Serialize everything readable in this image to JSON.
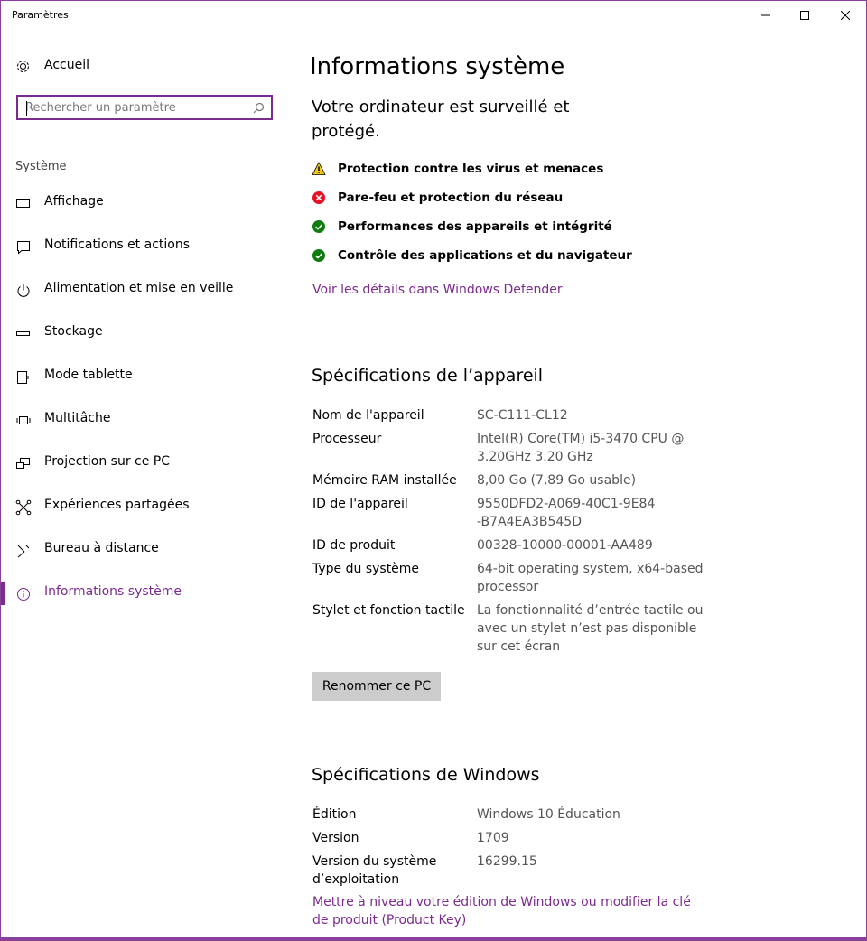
{
  "window": {
    "title": "Paramètres"
  },
  "sidebar": {
    "home_label": "Accueil",
    "search_placeholder": "Rechercher un paramètre",
    "section_label": "Système",
    "items": [
      {
        "label": "Affichage",
        "icon": "monitor-icon"
      },
      {
        "label": "Notifications et actions",
        "icon": "notification-icon"
      },
      {
        "label": "Alimentation et mise en veille",
        "icon": "power-icon"
      },
      {
        "label": "Stockage",
        "icon": "storage-icon"
      },
      {
        "label": "Mode tablette",
        "icon": "tablet-icon"
      },
      {
        "label": "Multitâche",
        "icon": "multitask-icon"
      },
      {
        "label": "Projection sur ce PC",
        "icon": "projection-icon"
      },
      {
        "label": "Expériences partagées",
        "icon": "share-icon"
      },
      {
        "label": "Bureau à distance",
        "icon": "remote-desktop-icon"
      },
      {
        "label": "Informations système",
        "icon": "info-icon",
        "active": true
      }
    ]
  },
  "main": {
    "title": "Informations système",
    "protection": {
      "heading": "Votre ordinateur est surveillé et protégé.",
      "items": [
        {
          "label": "Protection contre les virus et menaces",
          "status": "warning"
        },
        {
          "label": "Pare-feu et protection du réseau",
          "status": "error"
        },
        {
          "label": "Performances des appareils et intégrité",
          "status": "ok"
        },
        {
          "label": "Contrôle des applications et du navigateur",
          "status": "ok"
        }
      ],
      "link": "Voir les détails dans Windows Defender"
    },
    "device_specs": {
      "heading": "Spécifications de l’appareil",
      "rows": [
        {
          "key": "Nom de l'appareil",
          "value": "SC-C111-CL12"
        },
        {
          "key": "Processeur",
          "value": "Intel(R) Core(TM) i5-3470 CPU @ 3.20GHz   3.20 GHz"
        },
        {
          "key": "Mémoire RAM installée",
          "value": "8,00 Go (7,89 Go usable)"
        },
        {
          "key": "ID de l'appareil",
          "value": "9550DFD2-A069-40C1-9E84-B7A4EA3B545D"
        },
        {
          "key": "ID de produit",
          "value": "00328-10000-00001-AA489"
        },
        {
          "key": "Type du système",
          "value": "64-bit operating system, x64-based processor"
        },
        {
          "key": "Stylet et fonction tactile",
          "value": "La fonctionnalité d’entrée tactile ou avec un stylet n’est pas disponible sur cet écran"
        }
      ],
      "rename_button": "Renommer ce PC"
    },
    "windows_specs": {
      "heading": "Spécifications de Windows",
      "rows": [
        {
          "key": "Édition",
          "value": "Windows 10 Éducation"
        },
        {
          "key": "Version",
          "value": "1709"
        },
        {
          "key": "Version du système d’exploitation",
          "value": "16299.15"
        }
      ],
      "link": "Mettre à niveau votre édition de Windows ou modifier la clé de produit (Product Key)"
    }
  },
  "colors": {
    "accent": "#7b2a8e",
    "warning": "#f2c811",
    "error": "#e81123",
    "ok": "#107c10"
  }
}
